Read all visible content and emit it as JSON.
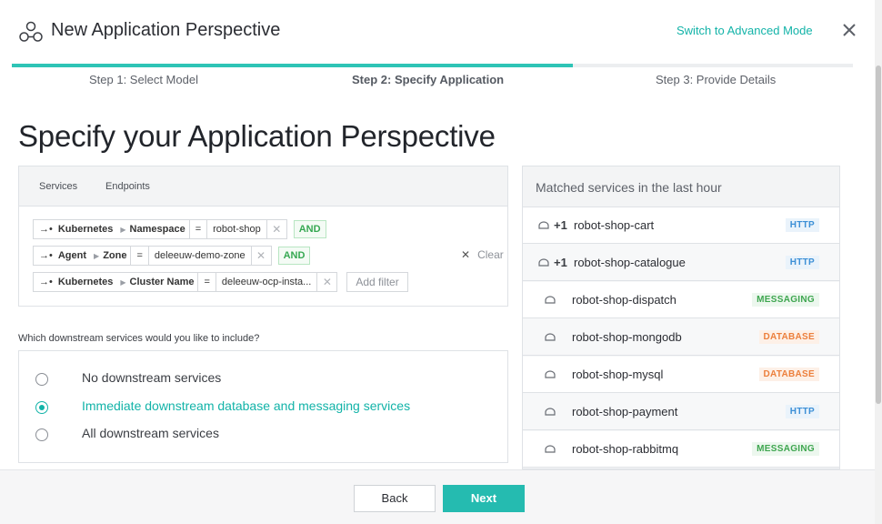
{
  "header": {
    "title": "New Application Perspective",
    "switch_mode_label": "Switch to Advanced Mode",
    "icon": "application-perspective-icon",
    "close_icon": "close-icon"
  },
  "steps": [
    {
      "label": "Step 1: Select Model"
    },
    {
      "label": "Step 2: Specify Application"
    },
    {
      "label": "Step 3: Provide Details"
    }
  ],
  "page_heading": "Specify your Application Perspective",
  "filter_panel": {
    "tabs": [
      "Services",
      "Endpoints"
    ],
    "filters": [
      {
        "entity": "Kubernetes",
        "tag": "Namespace",
        "operator": "=",
        "value": "robot-shop",
        "connector": "AND"
      },
      {
        "entity": "Agent",
        "tag": "Zone",
        "operator": "=",
        "value": "deleeuw-demo-zone",
        "connector": "AND"
      },
      {
        "entity": "Kubernetes",
        "tag": "Cluster Name",
        "operator": "=",
        "value": "deleeuw-ocp-insta..."
      }
    ],
    "add_filter_label": "Add filter",
    "clear_label": "Clear"
  },
  "downstream": {
    "question": "Which downstream services would you like to include?",
    "options": [
      {
        "label": "No downstream services",
        "selected": false
      },
      {
        "label": "Immediate downstream database and messaging services",
        "selected": true
      },
      {
        "label": "All downstream services",
        "selected": false
      }
    ]
  },
  "matched": {
    "title": "Matched services in the last hour",
    "services": [
      {
        "prefix": "+1",
        "name": "robot-shop-cart",
        "type": "HTTP"
      },
      {
        "prefix": "+1",
        "name": "robot-shop-catalogue",
        "type": "HTTP"
      },
      {
        "prefix": "",
        "name": "robot-shop-dispatch",
        "type": "MESSAGING"
      },
      {
        "prefix": "",
        "name": "robot-shop-mongodb",
        "type": "DATABASE"
      },
      {
        "prefix": "",
        "name": "robot-shop-mysql",
        "type": "DATABASE"
      },
      {
        "prefix": "",
        "name": "robot-shop-payment",
        "type": "HTTP"
      },
      {
        "prefix": "",
        "name": "robot-shop-rabbitmq",
        "type": "MESSAGING"
      }
    ]
  },
  "footer": {
    "back_label": "Back",
    "next_label": "Next"
  },
  "colors": {
    "accent": "#12b3a8",
    "primary_button": "#25bbb0",
    "http": "#3c8fd6",
    "messaging": "#3ea64f",
    "database": "#ec7f3c"
  }
}
